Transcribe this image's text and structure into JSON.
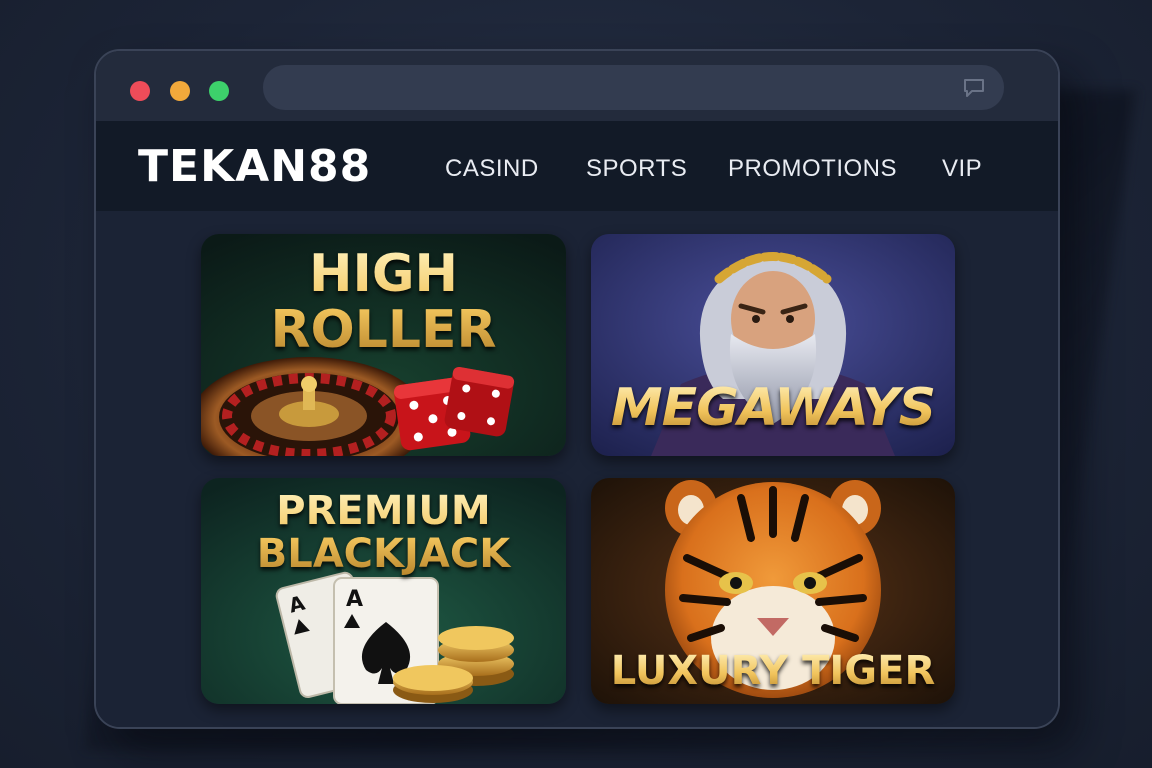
{
  "browser": {
    "window_dots": [
      "close",
      "minimize",
      "maximize"
    ],
    "address_icon": "chat-bubble-icon"
  },
  "site": {
    "logo": "TEKAN88",
    "nav": [
      {
        "label": "CASIND"
      },
      {
        "label": "SPORTS"
      },
      {
        "label": "PROMOTIONS"
      },
      {
        "label": "VIP"
      }
    ]
  },
  "games": [
    {
      "line1": "HIGH",
      "line2": "ROLLER"
    },
    {
      "title": "MEGAWAYS"
    },
    {
      "line1": "PREMIUM",
      "line2": "BLACKJACK"
    },
    {
      "title": "LUXURY TIGER"
    }
  ],
  "colors": {
    "page_bg": "#1c2436",
    "window_bg": "#161d2c",
    "titlebar": "#232b3c",
    "navbar": "#121a27",
    "gold_text": "#f1c45c",
    "dot_red": "#ee4c59",
    "dot_yellow": "#f2a93b",
    "dot_green": "#3dd16b"
  }
}
